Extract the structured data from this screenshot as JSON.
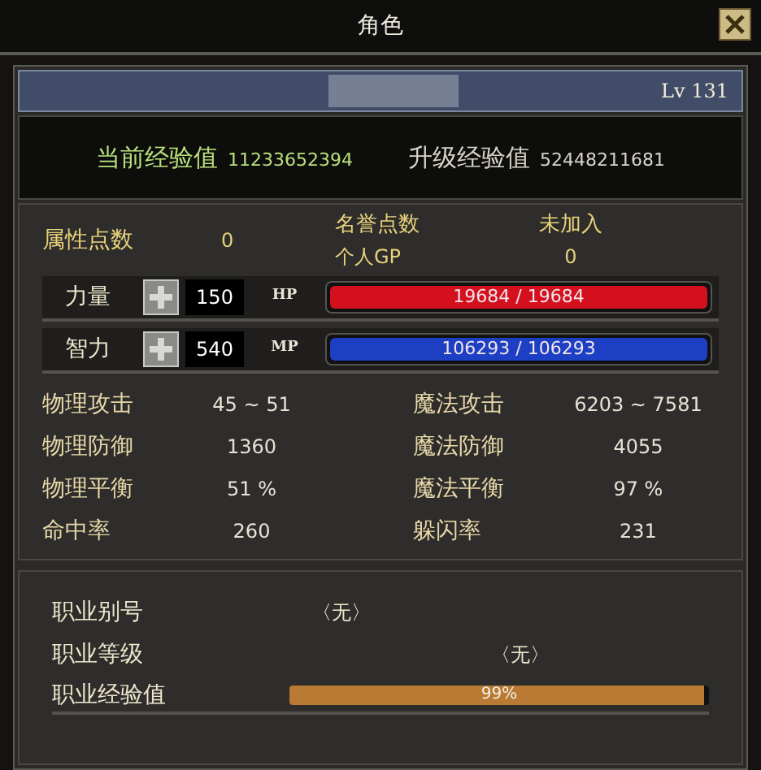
{
  "window": {
    "title": "角色"
  },
  "header": {
    "level": "Lv 131"
  },
  "experience": [
    {
      "label": "当前经验值",
      "value": "11233652394",
      "kind": "current"
    },
    {
      "label": "升级经验值",
      "value": "52448211681",
      "kind": "next"
    }
  ],
  "points": {
    "label": "属性点数",
    "value": "0",
    "honor_label": "名誉点数",
    "honor_value": "未加入",
    "gp_label": "个人GP",
    "gp_value": "0"
  },
  "stats": [
    {
      "label": "力量",
      "value": "150",
      "bar_label": "HP",
      "reading": "19684 / 19684",
      "level": 1,
      "color": "#d4101e"
    },
    {
      "label": "智力",
      "value": "540",
      "bar_label": "MP",
      "reading": "106293 / 106293",
      "level": 1,
      "color": "#1c3fc4"
    }
  ],
  "attributes": [
    {
      "label": "物理攻击",
      "value": "45 ~ 51",
      "label_2": "魔法攻击",
      "value_2": "6203 ~ 7581"
    },
    {
      "label": "物理防御",
      "value": "1360",
      "label_2": "魔法防御",
      "value_2": "4055"
    },
    {
      "label": "物理平衡",
      "value": "51 %",
      "label_2": "魔法平衡",
      "value_2": "97 %"
    },
    {
      "label": "命中率",
      "value": "260",
      "label_2": "躲闪率",
      "value_2": "231"
    }
  ],
  "job": {
    "alias_label": "职业别号",
    "alias": "〈无〉",
    "grade_label": "职业等级",
    "grade": "〈无〉",
    "exp_label": "职业经验值",
    "reading": "99%",
    "level": 0.99
  }
}
